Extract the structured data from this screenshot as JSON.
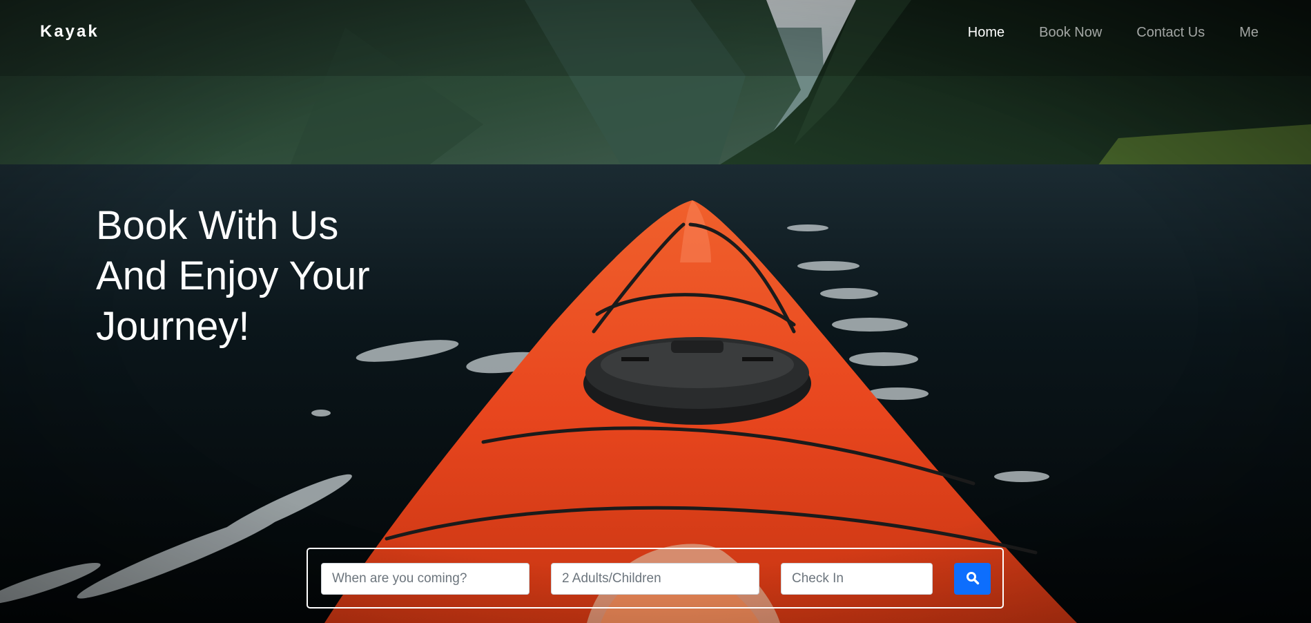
{
  "brand": "Kayak",
  "nav": {
    "items": [
      {
        "label": "Home",
        "active": true
      },
      {
        "label": "Book Now",
        "active": false
      },
      {
        "label": "Contact Us",
        "active": false
      },
      {
        "label": "Me",
        "active": false
      }
    ]
  },
  "hero": {
    "headline_lines": [
      "Book With Us",
      "And Enjoy Your",
      "Journey!"
    ]
  },
  "booking": {
    "when_placeholder": "When are you coming?",
    "guests_placeholder": "2 Adults/Children",
    "checkin_placeholder": "Check In",
    "search_icon": "search-icon"
  },
  "colors": {
    "primary": "#0d6efd",
    "kayak": "#e8461e",
    "text": "#ffffff"
  }
}
